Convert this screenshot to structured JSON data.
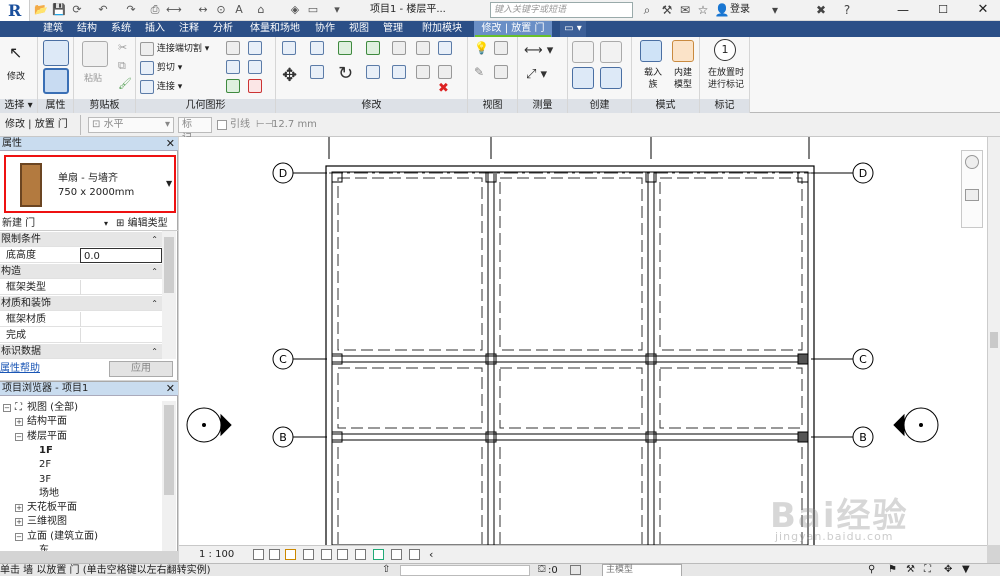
{
  "titlebar": {
    "project_title": "项目1 - 楼层平...",
    "search_placeholder": "键入关键字或短语",
    "login": "登录"
  },
  "menu": {
    "tabs": [
      "建筑",
      "结构",
      "系统",
      "插入",
      "注释",
      "分析",
      "体量和场地",
      "协作",
      "视图",
      "管理",
      "附加模块",
      "修改 | 放置 门"
    ]
  },
  "ribbon": {
    "select_panel": {
      "modify": "修改",
      "label": "选择"
    },
    "props_panel": {
      "label": "属性"
    },
    "clipboard": {
      "paste": "粘贴",
      "label": "剪贴板"
    },
    "geometry": {
      "join_cut": "连接端切割",
      "cut": "剪切",
      "join": "连接",
      "label": "几何图形"
    },
    "modify_label": "修改",
    "view_label": "视图",
    "measure_label": "测量",
    "create_label": "创建",
    "mode": {
      "load_family": "载入族",
      "in_place": "内建模型",
      "label": "模式"
    },
    "tag": {
      "tag_on_place": "在放置时进行标记",
      "label": "标记"
    }
  },
  "optionbar": {
    "context": "修改 | 放置 门",
    "orientation": "水平",
    "tag_box": "标记...",
    "leader": "引线",
    "leader_length": "12.7 mm"
  },
  "properties": {
    "title": "属性",
    "type_name": "单扇 - 与墙齐",
    "type_size": "750 x 2000mm",
    "instance_selector": "新建 门",
    "edit_type": "编辑类型",
    "rows": [
      {
        "kind": "group",
        "label": "限制条件"
      },
      {
        "kind": "param",
        "label": "底高度",
        "value": "0.0"
      },
      {
        "kind": "group",
        "label": "构造"
      },
      {
        "kind": "param",
        "label": "框架类型",
        "value": ""
      },
      {
        "kind": "group",
        "label": "材质和装饰"
      },
      {
        "kind": "param",
        "label": "框架材质",
        "value": ""
      },
      {
        "kind": "param",
        "label": "完成",
        "value": ""
      },
      {
        "kind": "group",
        "label": "标识数据"
      }
    ],
    "help_link": "属性帮助",
    "apply": "应用"
  },
  "browser": {
    "title": "项目浏览器 - 项目1",
    "items": [
      {
        "label": "视图 (全部)",
        "depth": 0,
        "toggle": "−"
      },
      {
        "label": "结构平面",
        "depth": 1,
        "toggle": "+"
      },
      {
        "label": "楼层平面",
        "depth": 1,
        "toggle": "−"
      },
      {
        "label": "1F",
        "depth": 2,
        "toggle": "",
        "bold": true
      },
      {
        "label": "2F",
        "depth": 2,
        "toggle": ""
      },
      {
        "label": "3F",
        "depth": 2,
        "toggle": ""
      },
      {
        "label": "场地",
        "depth": 2,
        "toggle": ""
      },
      {
        "label": "天花板平面",
        "depth": 1,
        "toggle": "+"
      },
      {
        "label": "三维视图",
        "depth": 1,
        "toggle": "+"
      },
      {
        "label": "立面 (建筑立面)",
        "depth": 1,
        "toggle": "−"
      },
      {
        "label": "东",
        "depth": 2,
        "toggle": ""
      }
    ]
  },
  "grid_labels": {
    "rows": [
      "D",
      "C",
      "B"
    ]
  },
  "viewbar": {
    "scale": "1 : 100"
  },
  "status": {
    "text": "单击 墙 以放置 门 (单击空格键以左右翻转实例)",
    "count": ":0",
    "model": "主模型"
  },
  "watermark": {
    "text": "Bai经验",
    "sub": "jingyan.baidu.com"
  }
}
